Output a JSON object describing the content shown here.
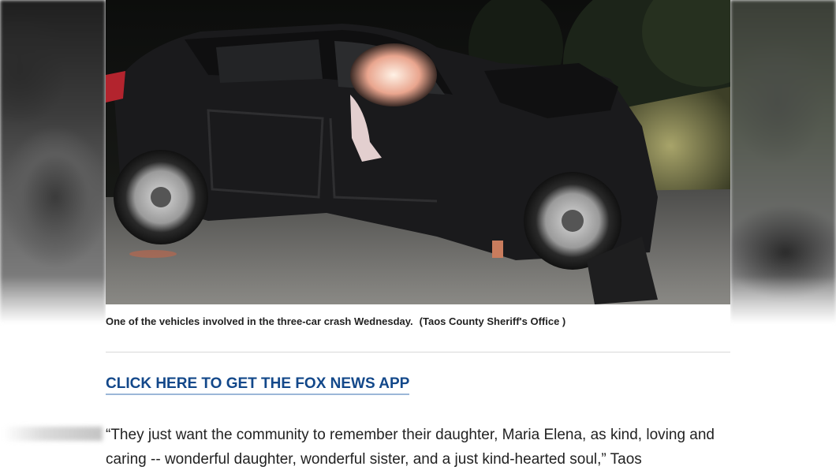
{
  "photo": {
    "alt_icon": "crashed-suv-photo"
  },
  "caption": {
    "text": "One of the vehicles involved in the three-car crash Wednesday.",
    "credit": "(Taos County Sheriff's Office )"
  },
  "app_link": {
    "label": "CLICK HERE TO GET THE FOX NEWS APP"
  },
  "body": {
    "paragraph": "“They just want the community to remember their daughter, Maria Elena, as kind, loving and caring -- wonderful daughter, wonderful sister, and a just kind-hearted soul,” Taos"
  },
  "colors": {
    "link": "#13488a",
    "text": "#222222",
    "caption": "#222222"
  }
}
